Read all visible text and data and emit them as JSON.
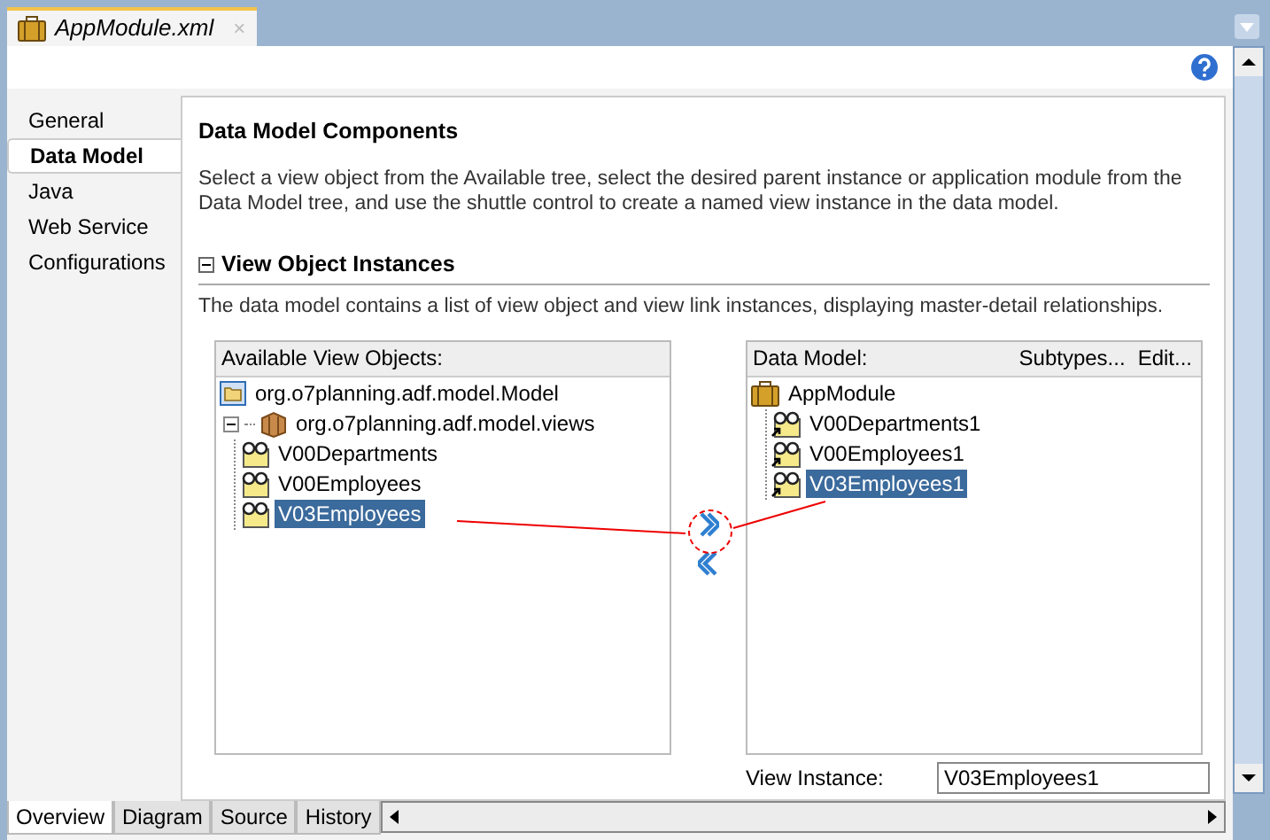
{
  "editor_tab": {
    "title": "AppModule.xml",
    "close": "×"
  },
  "nav": [
    {
      "label": "General",
      "selected": false
    },
    {
      "label": "Data Model",
      "selected": true
    },
    {
      "label": "Java",
      "selected": false
    },
    {
      "label": "Web Service",
      "selected": false
    },
    {
      "label": "Configurations",
      "selected": false
    }
  ],
  "section": {
    "title": "Data Model Components",
    "description": "Select a view object from the Available tree, select the desired parent instance or application module from the Data Model tree, and use the shuttle control to create a named view instance in the data model."
  },
  "subsection": {
    "title": "View Object Instances",
    "expanded": true,
    "description": "The data model contains a list of view object and view link instances, displaying master-detail relationships."
  },
  "available": {
    "label": "Available View Objects:",
    "tree": [
      {
        "label": "org.o7planning.adf.model.Model",
        "kind": "folder",
        "selected": false
      },
      {
        "label": "org.o7planning.adf.model.views",
        "kind": "package",
        "selected": false,
        "expanded": true,
        "children": [
          {
            "label": "V00Departments",
            "kind": "view",
            "selected": false
          },
          {
            "label": "V00Employees",
            "kind": "view",
            "selected": false
          },
          {
            "label": "V03Employees",
            "kind": "view",
            "selected": true
          }
        ]
      }
    ]
  },
  "data_model": {
    "label": "Data Model:",
    "actions": [
      "Subtypes...",
      "Edit..."
    ],
    "tree": [
      {
        "label": "AppModule",
        "kind": "module",
        "selected": false,
        "children": [
          {
            "label": "V00Departments1",
            "kind": "instance",
            "selected": false
          },
          {
            "label": "V00Employees1",
            "kind": "instance",
            "selected": false
          },
          {
            "label": "V03Employees1",
            "kind": "instance",
            "selected": true
          }
        ]
      }
    ]
  },
  "view_instance": {
    "label": "View Instance:",
    "value": "V03Employees1"
  },
  "bottom_tabs": [
    {
      "label": "Overview",
      "selected": true
    },
    {
      "label": "Diagram",
      "selected": false
    },
    {
      "label": "Source",
      "selected": false
    },
    {
      "label": "History",
      "selected": false
    }
  ]
}
